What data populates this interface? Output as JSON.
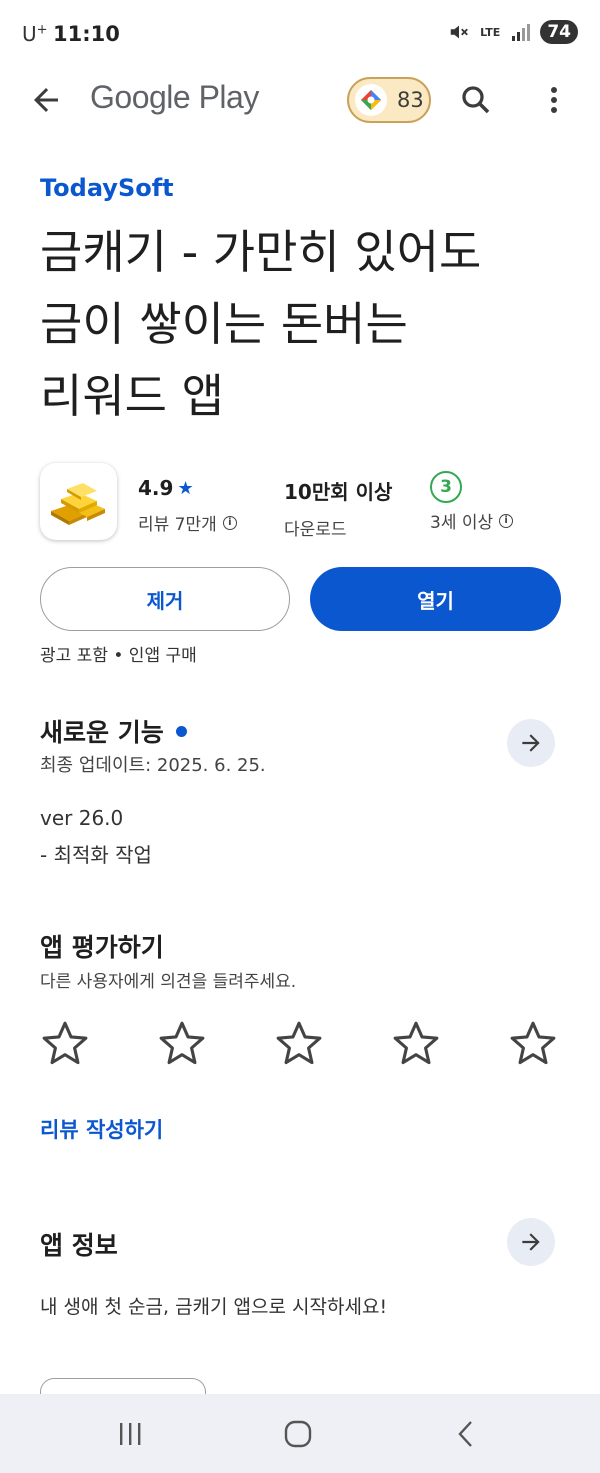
{
  "status": {
    "carrier": "U",
    "carrier_plus": "+",
    "time": "11:10",
    "network": "LTE",
    "battery": "74"
  },
  "header": {
    "title": "Google Play",
    "points": "83"
  },
  "app": {
    "developer": "TodaySoft",
    "title_line1": "금캐기 - 가만히 있어도",
    "title_line2": "금이 쌓이는 돈버는",
    "title_line3": "리워드 앱",
    "rating": "4.9",
    "rating_star": "★",
    "reviews_label": "리뷰 7만개",
    "downloads_value": "10만회 이상",
    "downloads_label": "다운로드",
    "age_rating": "3",
    "age_label": "3세 이상"
  },
  "actions": {
    "uninstall_label": "제거",
    "open_label": "열기",
    "ads_note": "광고 포함 • 인앱 구매"
  },
  "whats_new": {
    "title": "새로운 기능",
    "last_updated": "최종 업데이트: 2025. 6. 25.",
    "version": "ver 26.0",
    "notes": "- 최적화 작업"
  },
  "rate_app": {
    "title": "앱 평가하기",
    "subtitle": "다른 사용자에게 의견을 들려주세요.",
    "write_review": "리뷰 작성하기",
    "stars": [
      1,
      2,
      3,
      4,
      5
    ]
  },
  "about": {
    "title": "앱 정보",
    "description": "내 생애 첫 순금, 금캐기 앱으로 시작하세요!"
  },
  "colors": {
    "accent": "#0b57d0",
    "age_badge": "#34a853",
    "nav_bg": "#eef0f5"
  }
}
